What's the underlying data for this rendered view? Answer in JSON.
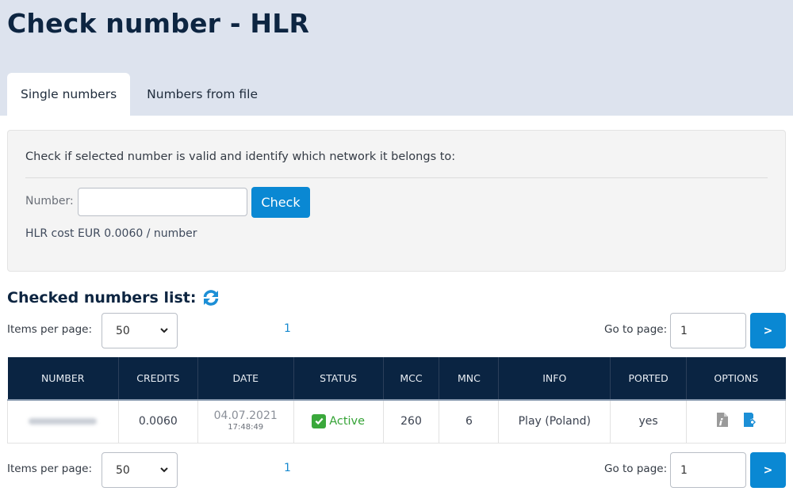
{
  "header": {
    "title": "Check number - HLR",
    "tabs": [
      {
        "label": "Single numbers",
        "active": true
      },
      {
        "label": "Numbers from file",
        "active": false
      }
    ]
  },
  "check_panel": {
    "description": "Check if selected number is valid and identify which network it belongs to:",
    "number_label": "Number:",
    "number_value": "",
    "number_placeholder": "",
    "check_button": "Check",
    "cost_text": "HLR cost EUR 0.0060 / number"
  },
  "list": {
    "title": "Checked numbers list:",
    "refresh_icon": "refresh-icon",
    "pager": {
      "items_per_page_label": "Items per page:",
      "items_per_page_value": "50",
      "current_page": "1",
      "goto_label": "Go to page:",
      "goto_value": "1",
      "goto_button": ">"
    },
    "columns": [
      "NUMBER",
      "CREDITS",
      "DATE",
      "STATUS",
      "MCC",
      "MNC",
      "INFO",
      "PORTED",
      "OPTIONS"
    ],
    "rows": [
      {
        "number": "(blurred)",
        "credits": "0.0060",
        "date": "04.07.2021",
        "time": "17:48:49",
        "status": "Active",
        "mcc": "260",
        "mnc": "6",
        "info": "Play (Poland)",
        "ported": "yes",
        "options": [
          "file-info-icon",
          "export-icon"
        ]
      }
    ]
  },
  "colors": {
    "accent": "#0a88d3",
    "header_bg": "#dde3ee",
    "table_header_bg": "#0a2442",
    "status_active": "#35a336",
    "title": "#0d2541"
  }
}
